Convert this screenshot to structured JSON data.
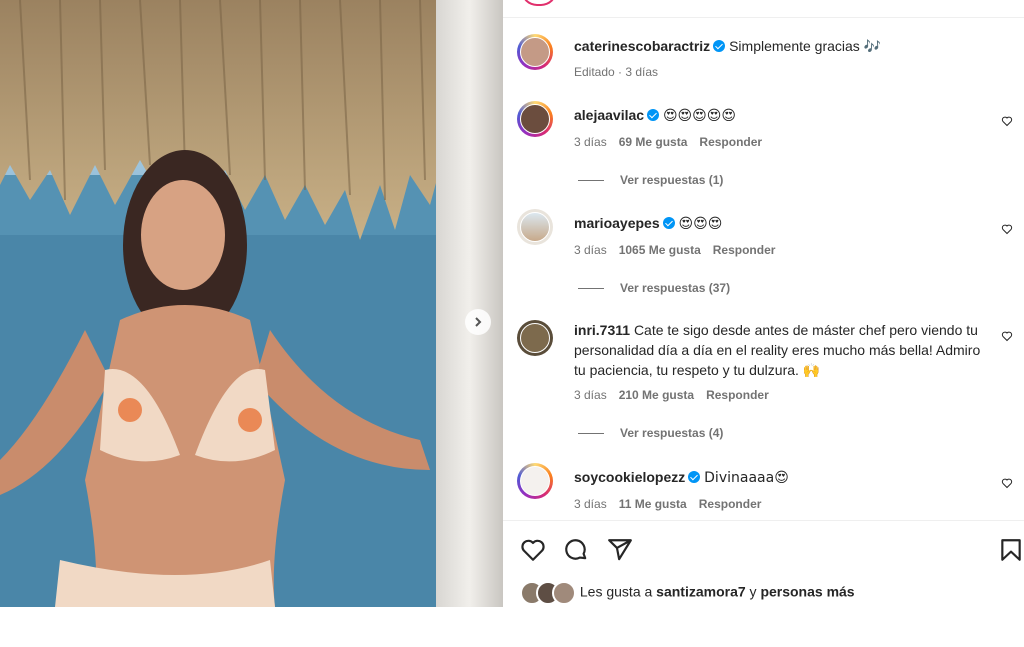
{
  "post": {
    "author": "caterinescobaractriz",
    "caption": "Simplemente gracias",
    "caption_emoji": "🎶",
    "caption_meta": "Editado · 3 días"
  },
  "comments": [
    {
      "user": "alejaavilac",
      "text": "😍😍😍😍😍",
      "time": "3 días",
      "likes": "69 Me gusta",
      "reply": "Responder",
      "view_replies": "Ver respuestas (1)"
    },
    {
      "user": "marioayepes",
      "text": "😍😍😍",
      "time": "3 días",
      "likes": "1065 Me gusta",
      "reply": "Responder",
      "view_replies": "Ver respuestas (37)"
    },
    {
      "user": "inri.7311",
      "text": "Cate te sigo desde antes de máster chef pero viendo tu personalidad día a día en el reality eres mucho más bella! Admiro tu paciencia, tu respeto y tu dulzura. 🙌",
      "time": "3 días",
      "likes": "210 Me gusta",
      "reply": "Responder",
      "view_replies": "Ver respuestas (4)"
    },
    {
      "user": "soycookielopezz",
      "text": "Divinaaaa😍",
      "time": "3 días",
      "likes": "11 Me gusta",
      "reply": "Responder"
    }
  ],
  "likes_line": {
    "prefix": "Les gusta a",
    "user": "santizamora7",
    "mid": "y",
    "suffix": "personas más"
  },
  "icons": {
    "like": "heart-icon",
    "comment": "comment-icon",
    "share": "share-icon",
    "save": "bookmark-icon",
    "next": "chevron-right-icon"
  },
  "colors": {
    "verified": "#0095f6",
    "meta_text": "#737373",
    "text": "#262626"
  }
}
